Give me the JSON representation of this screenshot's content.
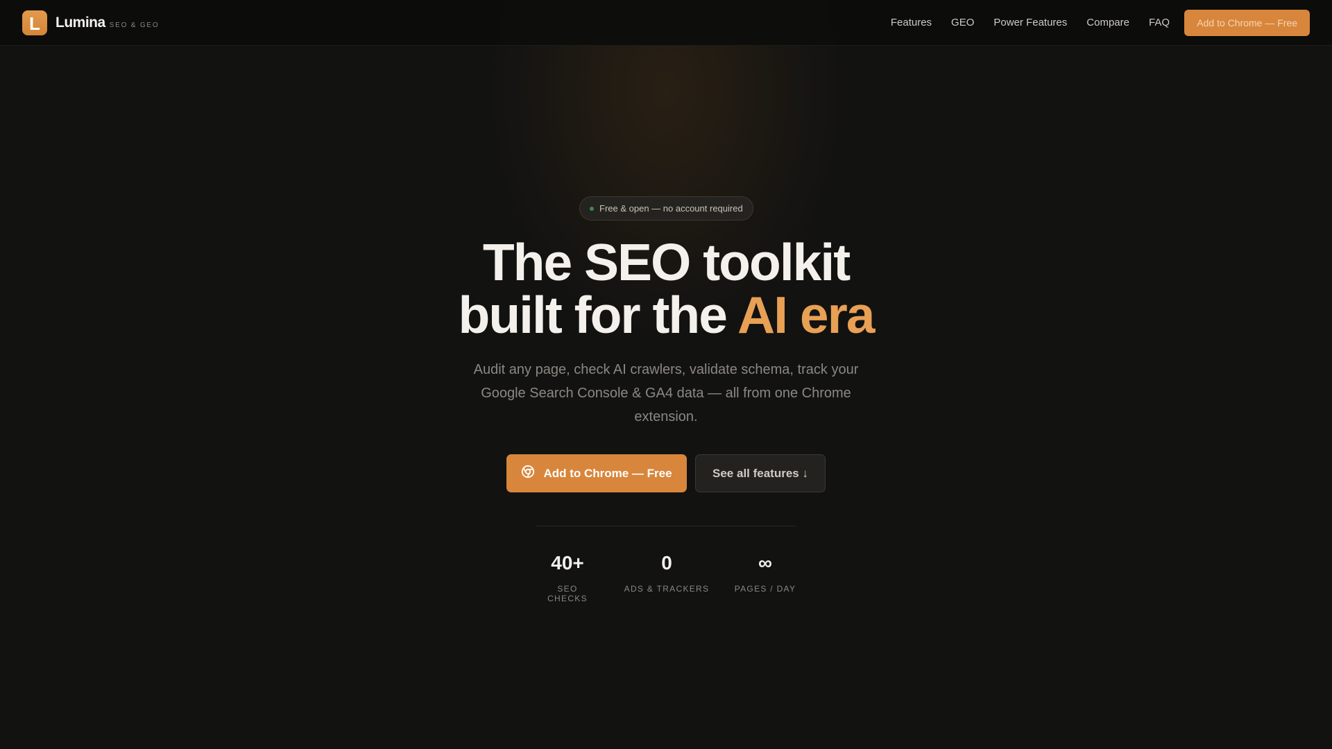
{
  "header": {
    "logo_letter": "L",
    "brand_name": "Lumina",
    "brand_tag": "SEO & GEO",
    "nav_links": [
      "Features",
      "GEO",
      "Power Features",
      "Compare",
      "FAQ"
    ],
    "cta_label": "Add to Chrome — Free"
  },
  "hero": {
    "badge": "Free & open — no account required",
    "headline_line1": "The SEO toolkit",
    "headline_line2_plain": "built for the ",
    "headline_line2_accent": "AI era",
    "subtitle": "Audit any page, check AI crawlers, validate schema, track your Google Search Console & GA4 data — all from one Chrome extension.",
    "primary_button": "Add to Chrome — Free",
    "primary_button_icon": "chrome-icon",
    "secondary_button": "See all features ↓"
  },
  "stats": [
    {
      "value": "40+",
      "label": "SEO CHECKS"
    },
    {
      "value": "0",
      "label": "ADS & TRACKERS"
    },
    {
      "value": "∞",
      "label": "PAGES / DAY"
    }
  ],
  "colors": {
    "accent": "#d8863c",
    "accent_text": "#e8a055",
    "background": "#121211",
    "status_dot": "#3f8a4a"
  }
}
